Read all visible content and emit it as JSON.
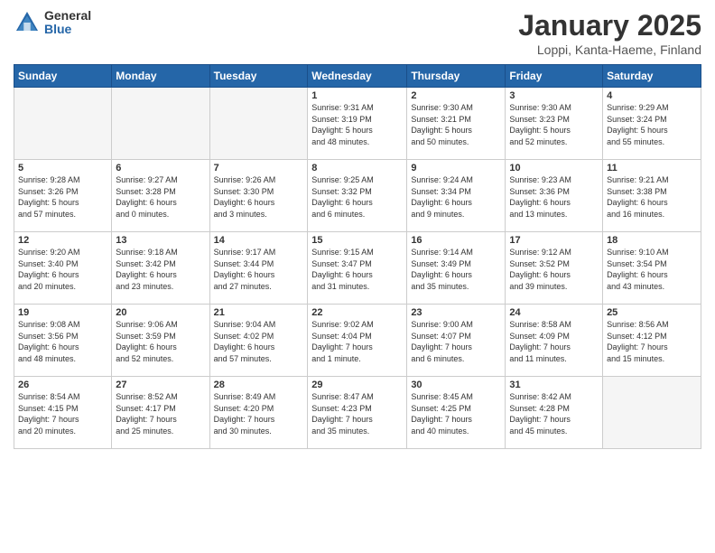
{
  "logo": {
    "general": "General",
    "blue": "Blue"
  },
  "title": "January 2025",
  "location": "Loppi, Kanta-Haeme, Finland",
  "days_of_week": [
    "Sunday",
    "Monday",
    "Tuesday",
    "Wednesday",
    "Thursday",
    "Friday",
    "Saturday"
  ],
  "weeks": [
    [
      {
        "day": "",
        "info": ""
      },
      {
        "day": "",
        "info": ""
      },
      {
        "day": "",
        "info": ""
      },
      {
        "day": "1",
        "info": "Sunrise: 9:31 AM\nSunset: 3:19 PM\nDaylight: 5 hours\nand 48 minutes."
      },
      {
        "day": "2",
        "info": "Sunrise: 9:30 AM\nSunset: 3:21 PM\nDaylight: 5 hours\nand 50 minutes."
      },
      {
        "day": "3",
        "info": "Sunrise: 9:30 AM\nSunset: 3:23 PM\nDaylight: 5 hours\nand 52 minutes."
      },
      {
        "day": "4",
        "info": "Sunrise: 9:29 AM\nSunset: 3:24 PM\nDaylight: 5 hours\nand 55 minutes."
      }
    ],
    [
      {
        "day": "5",
        "info": "Sunrise: 9:28 AM\nSunset: 3:26 PM\nDaylight: 5 hours\nand 57 minutes."
      },
      {
        "day": "6",
        "info": "Sunrise: 9:27 AM\nSunset: 3:28 PM\nDaylight: 6 hours\nand 0 minutes."
      },
      {
        "day": "7",
        "info": "Sunrise: 9:26 AM\nSunset: 3:30 PM\nDaylight: 6 hours\nand 3 minutes."
      },
      {
        "day": "8",
        "info": "Sunrise: 9:25 AM\nSunset: 3:32 PM\nDaylight: 6 hours\nand 6 minutes."
      },
      {
        "day": "9",
        "info": "Sunrise: 9:24 AM\nSunset: 3:34 PM\nDaylight: 6 hours\nand 9 minutes."
      },
      {
        "day": "10",
        "info": "Sunrise: 9:23 AM\nSunset: 3:36 PM\nDaylight: 6 hours\nand 13 minutes."
      },
      {
        "day": "11",
        "info": "Sunrise: 9:21 AM\nSunset: 3:38 PM\nDaylight: 6 hours\nand 16 minutes."
      }
    ],
    [
      {
        "day": "12",
        "info": "Sunrise: 9:20 AM\nSunset: 3:40 PM\nDaylight: 6 hours\nand 20 minutes."
      },
      {
        "day": "13",
        "info": "Sunrise: 9:18 AM\nSunset: 3:42 PM\nDaylight: 6 hours\nand 23 minutes."
      },
      {
        "day": "14",
        "info": "Sunrise: 9:17 AM\nSunset: 3:44 PM\nDaylight: 6 hours\nand 27 minutes."
      },
      {
        "day": "15",
        "info": "Sunrise: 9:15 AM\nSunset: 3:47 PM\nDaylight: 6 hours\nand 31 minutes."
      },
      {
        "day": "16",
        "info": "Sunrise: 9:14 AM\nSunset: 3:49 PM\nDaylight: 6 hours\nand 35 minutes."
      },
      {
        "day": "17",
        "info": "Sunrise: 9:12 AM\nSunset: 3:52 PM\nDaylight: 6 hours\nand 39 minutes."
      },
      {
        "day": "18",
        "info": "Sunrise: 9:10 AM\nSunset: 3:54 PM\nDaylight: 6 hours\nand 43 minutes."
      }
    ],
    [
      {
        "day": "19",
        "info": "Sunrise: 9:08 AM\nSunset: 3:56 PM\nDaylight: 6 hours\nand 48 minutes."
      },
      {
        "day": "20",
        "info": "Sunrise: 9:06 AM\nSunset: 3:59 PM\nDaylight: 6 hours\nand 52 minutes."
      },
      {
        "day": "21",
        "info": "Sunrise: 9:04 AM\nSunset: 4:02 PM\nDaylight: 6 hours\nand 57 minutes."
      },
      {
        "day": "22",
        "info": "Sunrise: 9:02 AM\nSunset: 4:04 PM\nDaylight: 7 hours\nand 1 minute."
      },
      {
        "day": "23",
        "info": "Sunrise: 9:00 AM\nSunset: 4:07 PM\nDaylight: 7 hours\nand 6 minutes."
      },
      {
        "day": "24",
        "info": "Sunrise: 8:58 AM\nSunset: 4:09 PM\nDaylight: 7 hours\nand 11 minutes."
      },
      {
        "day": "25",
        "info": "Sunrise: 8:56 AM\nSunset: 4:12 PM\nDaylight: 7 hours\nand 15 minutes."
      }
    ],
    [
      {
        "day": "26",
        "info": "Sunrise: 8:54 AM\nSunset: 4:15 PM\nDaylight: 7 hours\nand 20 minutes."
      },
      {
        "day": "27",
        "info": "Sunrise: 8:52 AM\nSunset: 4:17 PM\nDaylight: 7 hours\nand 25 minutes."
      },
      {
        "day": "28",
        "info": "Sunrise: 8:49 AM\nSunset: 4:20 PM\nDaylight: 7 hours\nand 30 minutes."
      },
      {
        "day": "29",
        "info": "Sunrise: 8:47 AM\nSunset: 4:23 PM\nDaylight: 7 hours\nand 35 minutes."
      },
      {
        "day": "30",
        "info": "Sunrise: 8:45 AM\nSunset: 4:25 PM\nDaylight: 7 hours\nand 40 minutes."
      },
      {
        "day": "31",
        "info": "Sunrise: 8:42 AM\nSunset: 4:28 PM\nDaylight: 7 hours\nand 45 minutes."
      },
      {
        "day": "",
        "info": ""
      }
    ]
  ]
}
